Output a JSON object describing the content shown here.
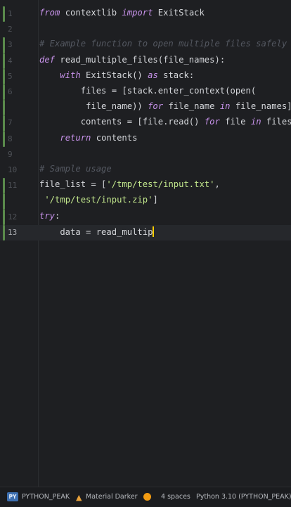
{
  "editor": {
    "lines": [
      {
        "n": "1",
        "tokens": [
          [
            "kw",
            "from"
          ],
          [
            "t",
            " contextlib "
          ],
          [
            "kw",
            "import"
          ],
          [
            "t",
            " ExitStack"
          ]
        ]
      },
      {
        "n": "2",
        "tokens": []
      },
      {
        "n": "3",
        "tokens": [
          [
            "cm",
            "# Example function to open multiple files safely"
          ]
        ]
      },
      {
        "n": "4",
        "tokens": [
          [
            "kw",
            "def"
          ],
          [
            "t",
            " read_multiple_files(file_names):"
          ]
        ]
      },
      {
        "n": "5",
        "tokens": [
          [
            "t",
            "    "
          ],
          [
            "kw",
            "with"
          ],
          [
            "t",
            " ExitStack() "
          ],
          [
            "kw",
            "as"
          ],
          [
            "t",
            " stack:"
          ]
        ]
      },
      {
        "n": "6",
        "tokens": [
          [
            "t",
            "        files = [stack.enter_context(open("
          ]
        ]
      },
      {
        "n": "",
        "tokens": [
          [
            "t",
            "         file_name)) "
          ],
          [
            "kw",
            "for"
          ],
          [
            "t",
            " file_name "
          ],
          [
            "kw",
            "in"
          ],
          [
            "t",
            " file_names]"
          ]
        ]
      },
      {
        "n": "7",
        "tokens": [
          [
            "t",
            "        contents = [file.read() "
          ],
          [
            "kw",
            "for"
          ],
          [
            "t",
            " file "
          ],
          [
            "kw",
            "in"
          ],
          [
            "t",
            " files]"
          ]
        ]
      },
      {
        "n": "8",
        "tokens": [
          [
            "t",
            "    "
          ],
          [
            "kw",
            "return"
          ],
          [
            "t",
            " contents"
          ]
        ]
      },
      {
        "n": "9",
        "tokens": []
      },
      {
        "n": "10",
        "tokens": [
          [
            "cm",
            "# Sample usage"
          ]
        ]
      },
      {
        "n": "11",
        "tokens": [
          [
            "t",
            "file_list = ["
          ],
          [
            "st",
            "'/tmp/test/input.txt'"
          ],
          [
            "t",
            ","
          ]
        ]
      },
      {
        "n": "",
        "tokens": [
          [
            "t",
            " "
          ],
          [
            "st",
            "'/tmp/test/input.zip'"
          ],
          [
            "t",
            "]"
          ]
        ]
      },
      {
        "n": "12",
        "tokens": [
          [
            "kw",
            "try"
          ],
          [
            "t",
            ":"
          ]
        ]
      },
      {
        "n": "13",
        "tokens": [
          [
            "t",
            "    data = read_multip"
          ],
          [
            "caret",
            ""
          ]
        ],
        "current": true
      }
    ]
  },
  "statusbar": {
    "project_badge": "PY",
    "project_name": "PYTHON_PEAK",
    "theme_name": "Material Darker",
    "indent": "4 spaces",
    "interpreter": "Python 3.10 (PYTHON_PEAK)"
  },
  "colors": {
    "background": "#1e1f22",
    "keyword": "#c792ea",
    "comment": "#545861",
    "string": "#c3e88d",
    "vcs_added": "#5a8a4b",
    "caret": "#ffcc00"
  }
}
